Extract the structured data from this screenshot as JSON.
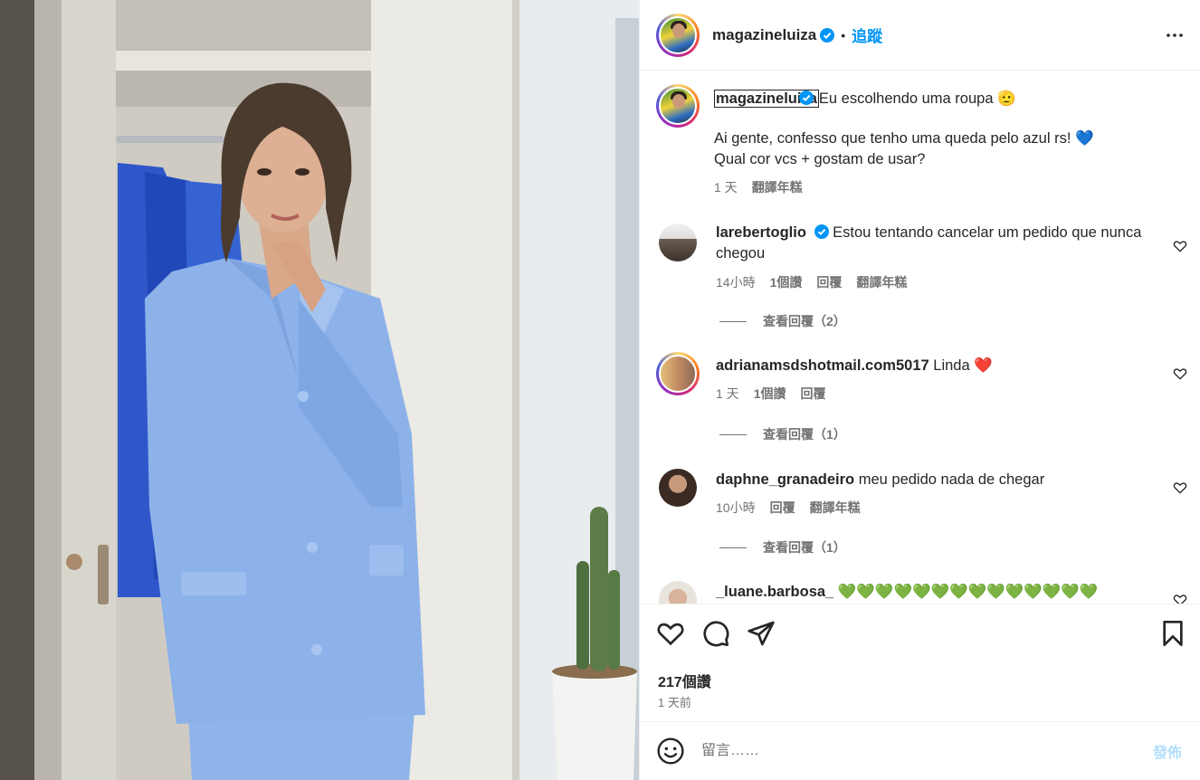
{
  "post": {
    "username": "magazineluiza",
    "follow_label": "追蹤",
    "dot": "•",
    "caption": {
      "user": "magazineluiza",
      "title": "Eu escolhendo uma roupa 🫡",
      "line1": "Ai gente, confesso que tenho uma queda pelo azul rs! 💙",
      "line2": "Qual cor vcs + gostam de usar?",
      "time": "1 天",
      "translate": "翻譯年糕"
    }
  },
  "comments": [
    {
      "user": "larebertoglio",
      "verified": true,
      "text": "Estou tentando cancelar um pedido que nunca chegou",
      "time": "14小時",
      "likes": "1個讚",
      "reply": "回覆",
      "translate": "翻譯年糕",
      "view_replies": "查看回覆（2）"
    },
    {
      "user": "adrianamsdshotmail.com5017",
      "text": "Linda ❤️",
      "time": "1 天",
      "likes": "1個讚",
      "reply": "回覆",
      "view_replies": "查看回覆（1）"
    },
    {
      "user": "daphne_granadeiro",
      "text": "meu pedido nada de chegar",
      "time": "10小時",
      "reply": "回覆",
      "translate": "翻譯年糕",
      "view_replies": "查看回覆（1）"
    },
    {
      "user": "_luane.barbosa_",
      "text": "💚💚💚💚💚💚💚💚💚💚💚💚💚💚"
    }
  ],
  "stats": {
    "likes": "217個讚",
    "ago": "1 天前"
  },
  "compose": {
    "placeholder": "留言……",
    "post_label": "發佈"
  },
  "icons": {
    "like": "heart-icon",
    "comment": "comment-bubble-icon",
    "share": "paper-plane-icon",
    "save": "bookmark-icon",
    "more": "more-horizontal-icon",
    "emoji": "smiley-icon"
  },
  "colors": {
    "accent": "#0095f6",
    "post_disabled": "#b2dffc",
    "secondary_text": "#737373"
  }
}
